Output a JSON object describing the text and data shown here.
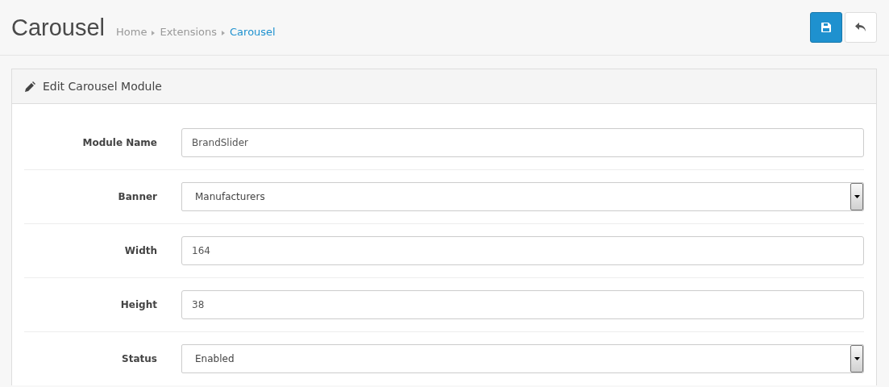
{
  "page_title": "Carousel",
  "breadcrumb": [
    {
      "label": "Home",
      "selected": false
    },
    {
      "label": "Extensions",
      "selected": false
    },
    {
      "label": "Carousel",
      "selected": true
    }
  ],
  "panel": {
    "title": "Edit Carousel Module",
    "fields": [
      {
        "kind": "text",
        "label": "Module Name",
        "value": "BrandSlider"
      },
      {
        "kind": "select",
        "label": "Banner",
        "value": "Manufacturers"
      },
      {
        "kind": "text",
        "label": "Width",
        "value": "164"
      },
      {
        "kind": "text",
        "label": "Height",
        "value": "38"
      },
      {
        "kind": "select",
        "label": "Status",
        "value": "Enabled"
      }
    ]
  }
}
